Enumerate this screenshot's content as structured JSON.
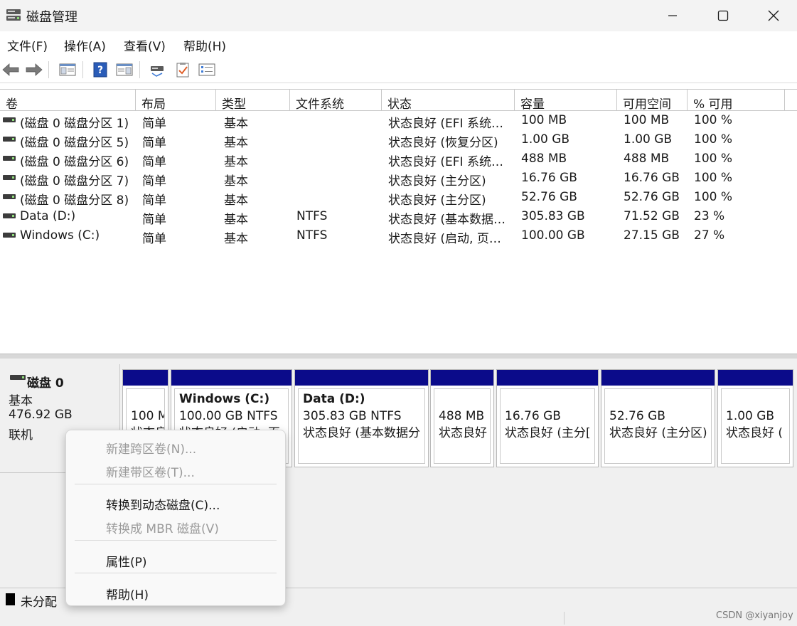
{
  "window": {
    "title": "磁盘管理"
  },
  "menu": [
    "文件(F)",
    "操作(A)",
    "查看(V)",
    "帮助(H)"
  ],
  "toolbar": {
    "icons": [
      "back-arrow-icon",
      "forward-arrow-icon",
      "console-tree-icon",
      "help-icon",
      "action-pane-icon",
      "disk-connect-icon",
      "properties-check-icon",
      "list-view-icon"
    ]
  },
  "table": {
    "headers": [
      "卷",
      "布局",
      "类型",
      "文件系统",
      "状态",
      "容量",
      "可用空间",
      "% 可用"
    ],
    "rows": [
      [
        "(磁盘 0 磁盘分区 1)",
        "简单",
        "基本",
        "",
        "状态良好 (EFI 系统…",
        "100 MB",
        "100 MB",
        "100 %"
      ],
      [
        "(磁盘 0 磁盘分区 5)",
        "简单",
        "基本",
        "",
        "状态良好 (恢复分区)",
        "1.00 GB",
        "1.00 GB",
        "100 %"
      ],
      [
        "(磁盘 0 磁盘分区 6)",
        "简单",
        "基本",
        "",
        "状态良好 (EFI 系统…",
        "488 MB",
        "488 MB",
        "100 %"
      ],
      [
        "(磁盘 0 磁盘分区 7)",
        "简单",
        "基本",
        "",
        "状态良好 (主分区)",
        "16.76 GB",
        "16.76 GB",
        "100 %"
      ],
      [
        "(磁盘 0 磁盘分区 8)",
        "简单",
        "基本",
        "",
        "状态良好 (主分区)",
        "52.76 GB",
        "52.76 GB",
        "100 %"
      ],
      [
        "Data (D:)",
        "简单",
        "基本",
        "NTFS",
        "状态良好 (基本数据…",
        "305.83 GB",
        "71.52 GB",
        "23 %"
      ],
      [
        "Windows (C:)",
        "简单",
        "基本",
        "NTFS",
        "状态良好 (启动, 页…",
        "100.00 GB",
        "27.15 GB",
        "27 %"
      ]
    ]
  },
  "disk": {
    "name": "磁盘 0",
    "type": "基本",
    "size": "476.92 GB",
    "status": "联机"
  },
  "partitions": [
    {
      "title": "",
      "size": "100 M",
      "status": "状态良"
    },
    {
      "title": "Windows  (C:)",
      "size": "100.00 GB NTFS",
      "status": "状态良好 (启动, 页"
    },
    {
      "title": "Data  (D:)",
      "size": "305.83 GB NTFS",
      "status": "状态良好 (基本数据分"
    },
    {
      "title": "",
      "size": "488 MB",
      "status": "状态良好"
    },
    {
      "title": "",
      "size": "16.76 GB",
      "status": "状态良好 (主分["
    },
    {
      "title": "",
      "size": "52.76 GB",
      "status": "状态良好 (主分区)"
    },
    {
      "title": "",
      "size": "1.00 GB",
      "status": "状态良好 ("
    }
  ],
  "legend": {
    "unallocated": "未分配"
  },
  "context_menu": {
    "new_spanned": "新建跨区卷(N)...",
    "new_striped": "新建带区卷(T)...",
    "convert_dynamic": "转换到动态磁盘(C)...",
    "convert_mbr": "转换成 MBR 磁盘(V)",
    "properties": "属性(P)",
    "help": "帮助(H)"
  },
  "watermark": "CSDN @xiyanjoy",
  "colors": {
    "partition_bar": "#0b0b8a",
    "accent_check": "#e0602a"
  }
}
